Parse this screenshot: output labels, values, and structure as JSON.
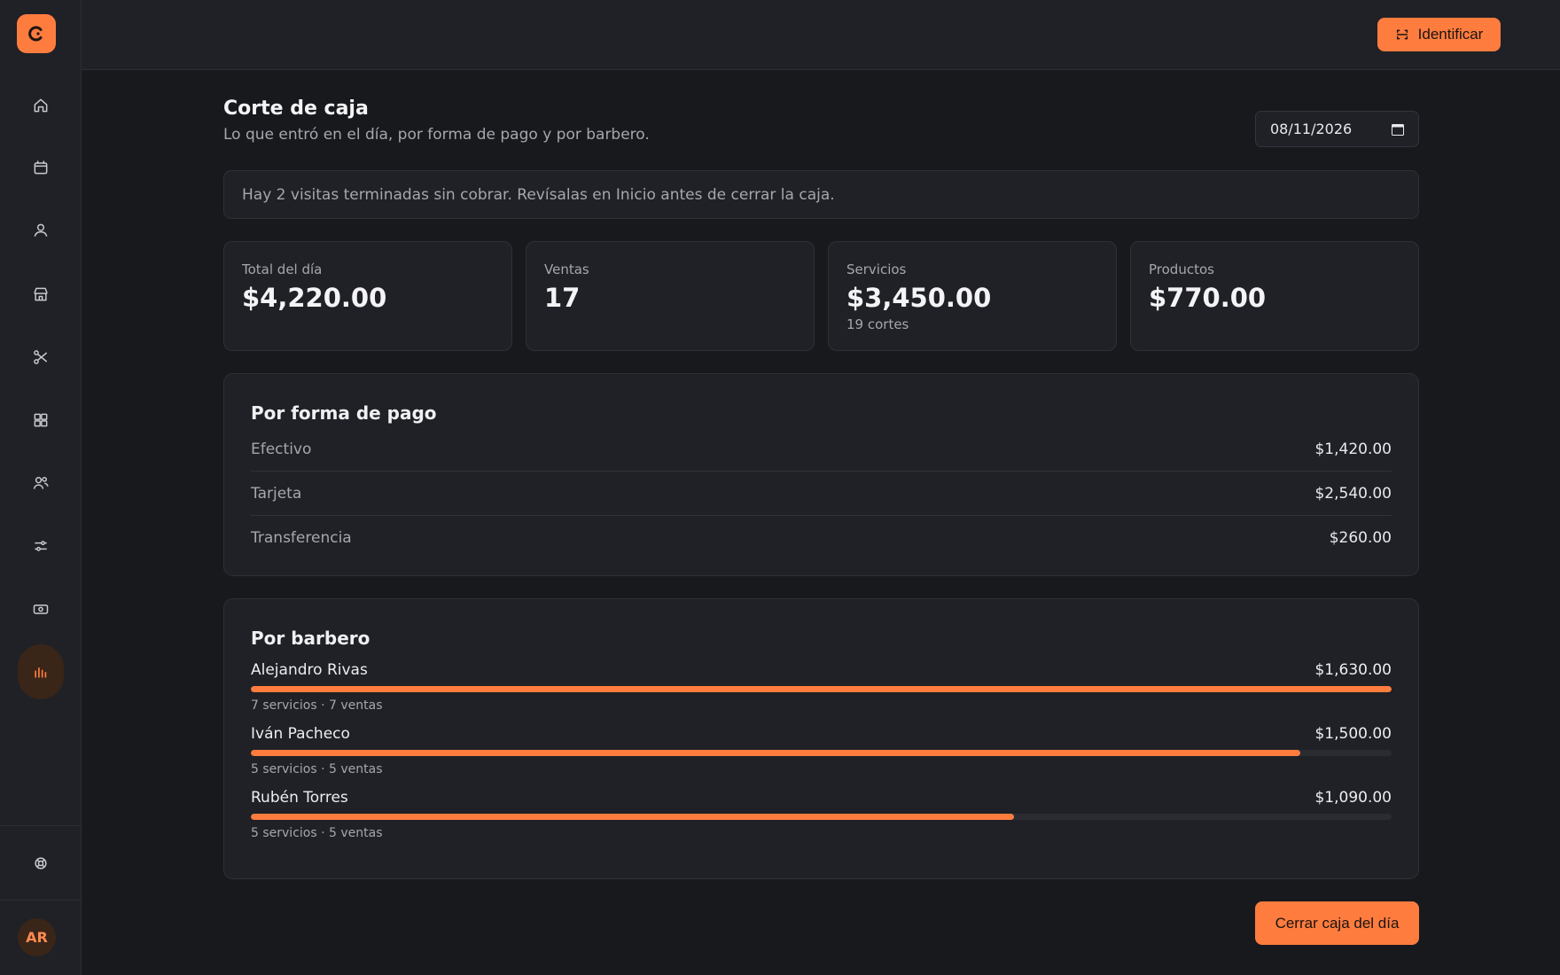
{
  "sidebar": {
    "logo_icon": "logo-c-icon",
    "items": [
      {
        "icon": "home-icon"
      },
      {
        "icon": "calendar-icon"
      },
      {
        "icon": "user-icon"
      },
      {
        "icon": "store-icon"
      },
      {
        "icon": "scissors-icon"
      },
      {
        "icon": "grid-icon"
      },
      {
        "icon": "users-icon"
      },
      {
        "icon": "sliders-icon"
      },
      {
        "icon": "cash-icon"
      },
      {
        "icon": "bar-chart-icon",
        "active": true
      }
    ],
    "help_icon": "lifebuoy-icon",
    "avatar": "AR"
  },
  "topbar": {
    "identify_label": "Identificar",
    "identify_icon": "scan-icon"
  },
  "page": {
    "title": "Corte de caja",
    "subtitle": "Lo que entró en el día, por forma de pago y por barbero.",
    "date_value": "08/11/2026",
    "alert": "Hay 2 visitas terminadas sin cobrar. Revísalas en Inicio antes de cerrar la caja."
  },
  "stats": [
    {
      "label": "Total del día",
      "value": "$4,220.00",
      "sub": ""
    },
    {
      "label": "Ventas",
      "value": "17",
      "sub": ""
    },
    {
      "label": "Servicios",
      "value": "$3,450.00",
      "sub": "19 cortes"
    },
    {
      "label": "Productos",
      "value": "$770.00",
      "sub": ""
    }
  ],
  "payments": {
    "title": "Por forma de pago",
    "rows": [
      {
        "name": "Efectivo",
        "amount": "$1,420.00"
      },
      {
        "name": "Tarjeta",
        "amount": "$2,540.00"
      },
      {
        "name": "Transferencia",
        "amount": "$260.00"
      }
    ]
  },
  "barbers": {
    "title": "Por barbero",
    "rows": [
      {
        "name": "Alejandro Rivas",
        "amount": "$1,630.00",
        "meta": "7 servicios · 7 ventas",
        "share": 1.0
      },
      {
        "name": "Iván Pacheco",
        "amount": "$1,500.00",
        "meta": "5 servicios · 5 ventas",
        "share": 0.92
      },
      {
        "name": "Rubén Torres",
        "amount": "$1,090.00",
        "meta": "5 servicios · 5 ventas",
        "share": 0.669
      }
    ]
  },
  "footer": {
    "close_label": "Cerrar caja del día"
  },
  "colors": {
    "accent": "#ff7c3f",
    "background": "#18191d",
    "surface": "#1f2126"
  }
}
